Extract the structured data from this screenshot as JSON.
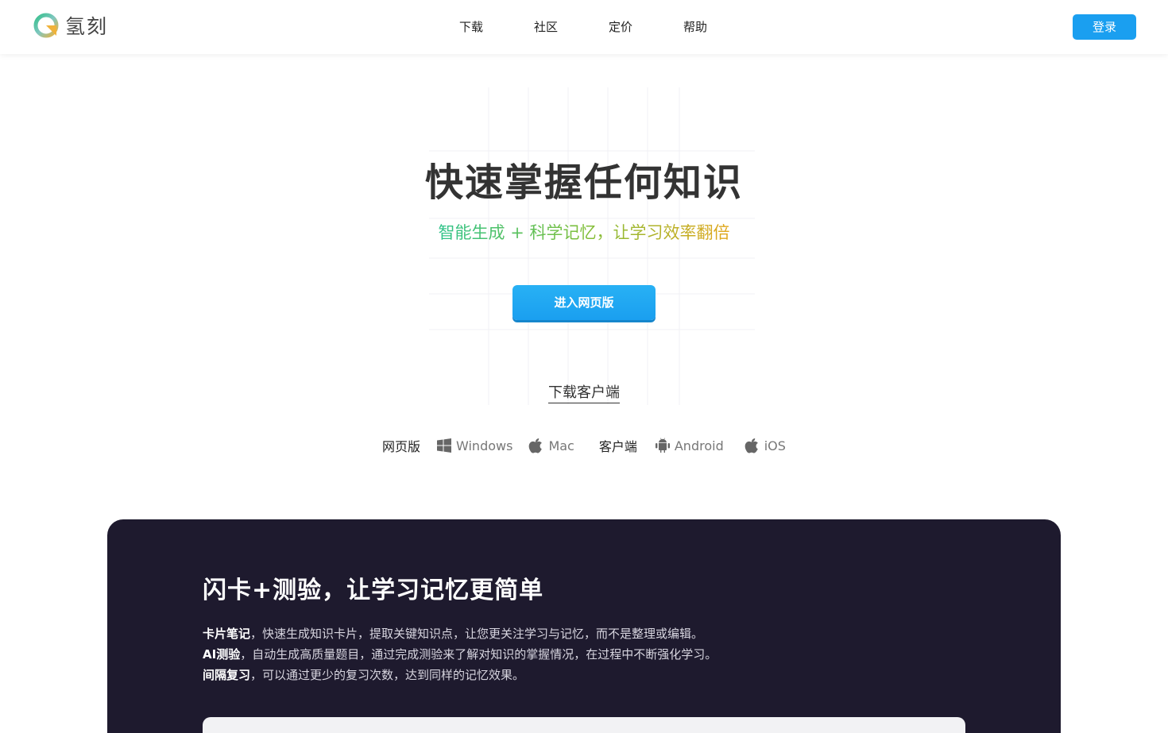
{
  "brand": {
    "name": "氢刻"
  },
  "nav": {
    "items": [
      {
        "label": "下载"
      },
      {
        "label": "社区"
      },
      {
        "label": "定价"
      },
      {
        "label": "帮助"
      }
    ]
  },
  "header": {
    "login_label": "登录"
  },
  "hero": {
    "title": "快速掌握任何知识",
    "subtitle": "智能生成 + 科学记忆，让学习效率翻倍",
    "cta_label": "进入网页版",
    "download_link": "下载客户端"
  },
  "platforms": {
    "web_label": "网页版",
    "client_label": "客户端",
    "items": [
      {
        "name": "Windows",
        "icon": "windows-icon"
      },
      {
        "name": "Mac",
        "icon": "apple-icon"
      },
      {
        "name": "Android",
        "icon": "android-icon"
      },
      {
        "name": "iOS",
        "icon": "apple-icon"
      }
    ]
  },
  "feature": {
    "title": "闪卡+测验，让学习记忆更简单",
    "lines": [
      {
        "term": "卡片笔记",
        "text": "，快速生成知识卡片，提取关键知识点，让您更关注学习与记忆，而不是整理或编辑。"
      },
      {
        "term": "AI测验",
        "text": "，自动生成高质量题目，通过完成测验来了解对知识的掌握情况，在过程中不断强化学习。"
      },
      {
        "term": "间隔复习",
        "text": "，可以通过更少的复习次数，达到同样的记忆效果。"
      }
    ]
  },
  "colors": {
    "accent": "#1a9ff0",
    "dark_section": "#1e1a2e",
    "gradient_start": "#2ec38a",
    "gradient_end": "#e2a61a"
  }
}
